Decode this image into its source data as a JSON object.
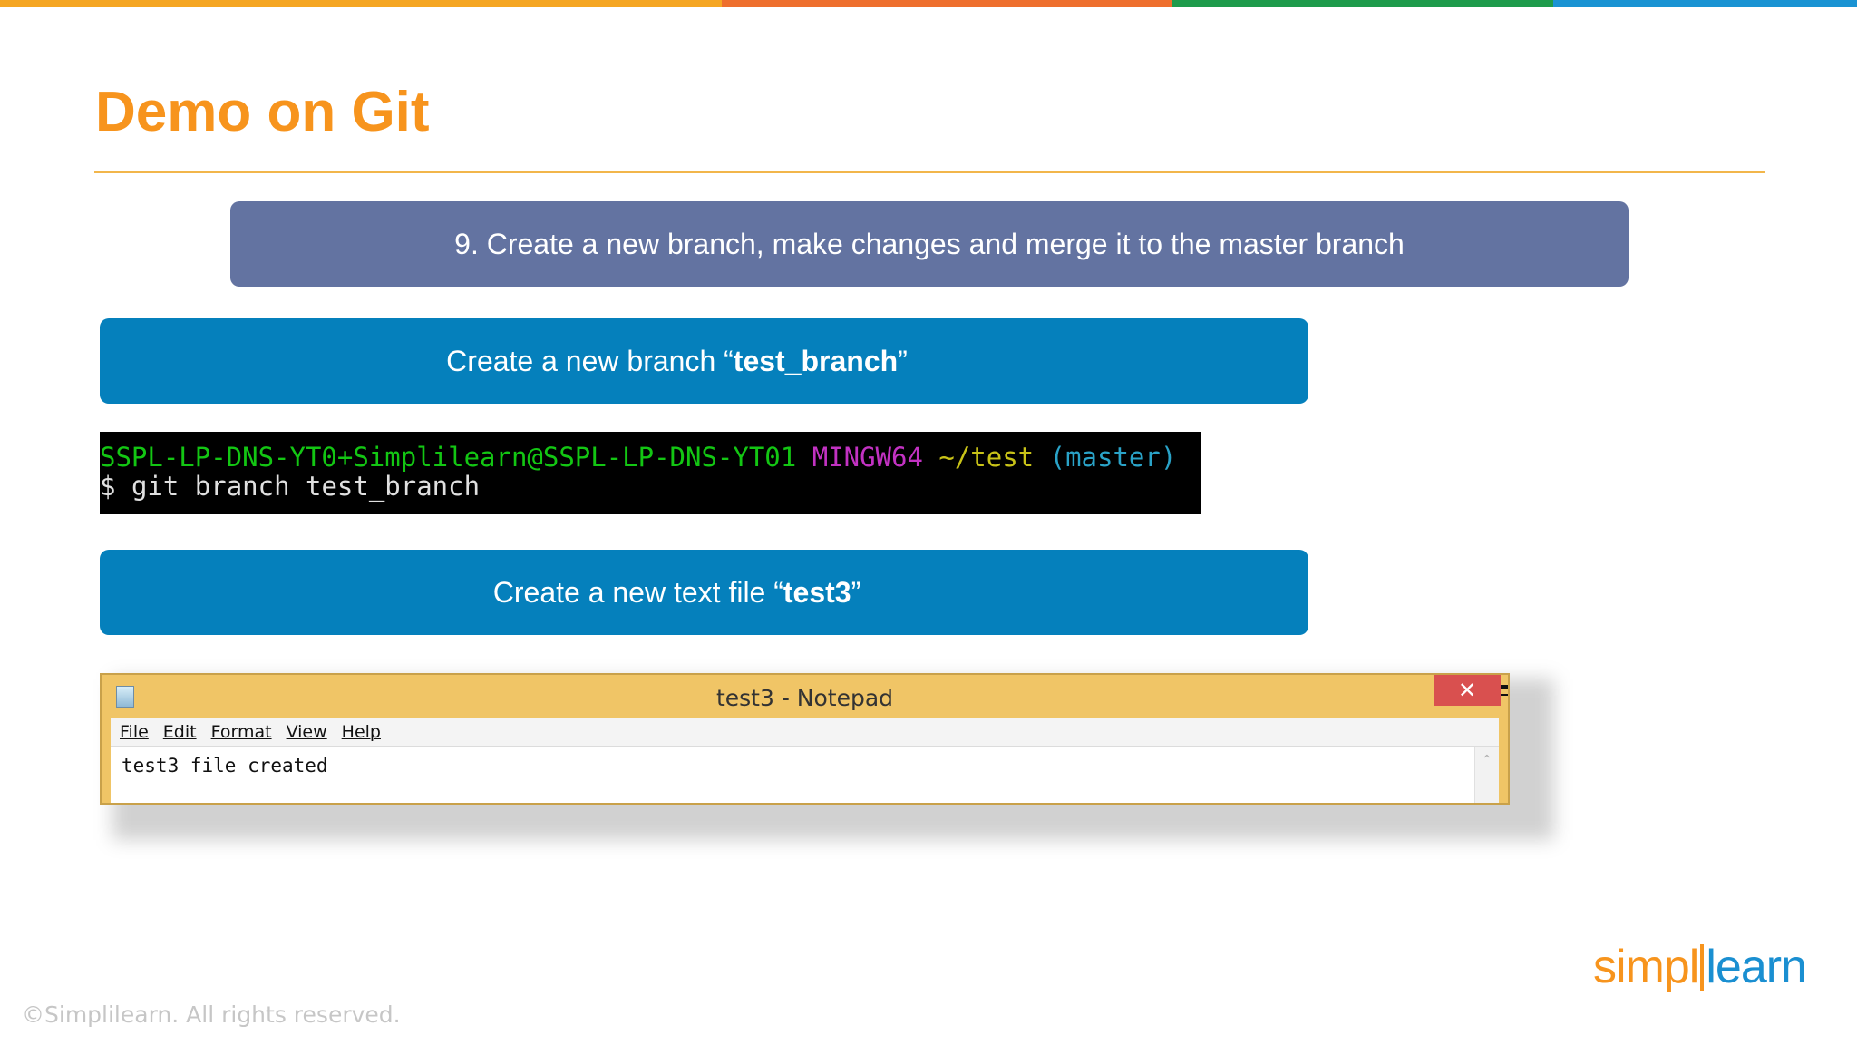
{
  "colors": {
    "top_bar": [
      "#f5a623",
      "#ee6f2d",
      "#1e9b4b",
      "#1a93d3"
    ],
    "title": "#f7941d",
    "step_banner": "#6373a1",
    "instruction_box": "#0580bc",
    "terminal_bg": "#000000",
    "notepad_frame": "#f0c566",
    "notepad_close": "#d9504f"
  },
  "slide": {
    "title": "Demo on Git",
    "step": "9. Create a new branch, make changes and merge it to the master branch"
  },
  "instructions": [
    {
      "prefix": "Create a new branch “",
      "bold": "test_branch",
      "suffix": "”"
    },
    {
      "prefix": "Create a new text file “",
      "bold": "test3",
      "suffix": "”"
    }
  ],
  "terminal": {
    "user_host": "SSPL-LP-DNS-YT0+Simplilearn@SSPL-LP-DNS-YT01",
    "shell": "MINGW64",
    "path": "~/test",
    "branch": "(master)",
    "prompt": "$",
    "command": "git branch test_branch"
  },
  "notepad": {
    "title": "test3 - Notepad",
    "app_icon": "notepad-icon",
    "close_glyph": "✕",
    "menu": [
      "File",
      "Edit",
      "Format",
      "View",
      "Help"
    ],
    "content": "test3 file created"
  },
  "footer": {
    "copyright": "©Simplilearn. All rights reserved.",
    "logo_left": "simpl",
    "logo_right": "learn"
  }
}
